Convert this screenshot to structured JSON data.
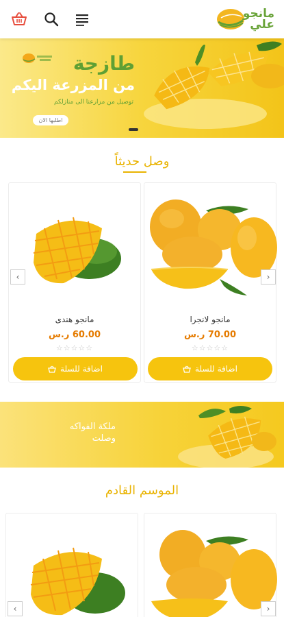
{
  "header": {
    "brand": "مانجو\nعلي",
    "icons": [
      "basket-icon",
      "search-icon",
      "menu-icon"
    ]
  },
  "hero": {
    "title": "طازجة",
    "subtitle": "من المزرعة اليكم",
    "description": "توصيل من مزارعنا الى منازلكم",
    "button_label": "اطلبها الان"
  },
  "sections": {
    "new_arrivals": "وصل حديثاً",
    "next_season": "الموسم القادم"
  },
  "products_new": [
    {
      "name": "مانجو هندى",
      "price": "60.00 ر.س",
      "stars": "☆☆☆☆☆",
      "button": "اضافة للسلة"
    },
    {
      "name": "مانجو لانجرا",
      "price": "70.00 ر.س",
      "stars": "☆☆☆☆☆",
      "button": "اضافة للسلة"
    }
  ],
  "promo": {
    "line1": "ملكة الفواكه",
    "line2": "وصلت"
  },
  "colors": {
    "accent": "#f6c40e",
    "title": "#e9b300",
    "price": "#e57b00",
    "green": "#5fa034"
  }
}
